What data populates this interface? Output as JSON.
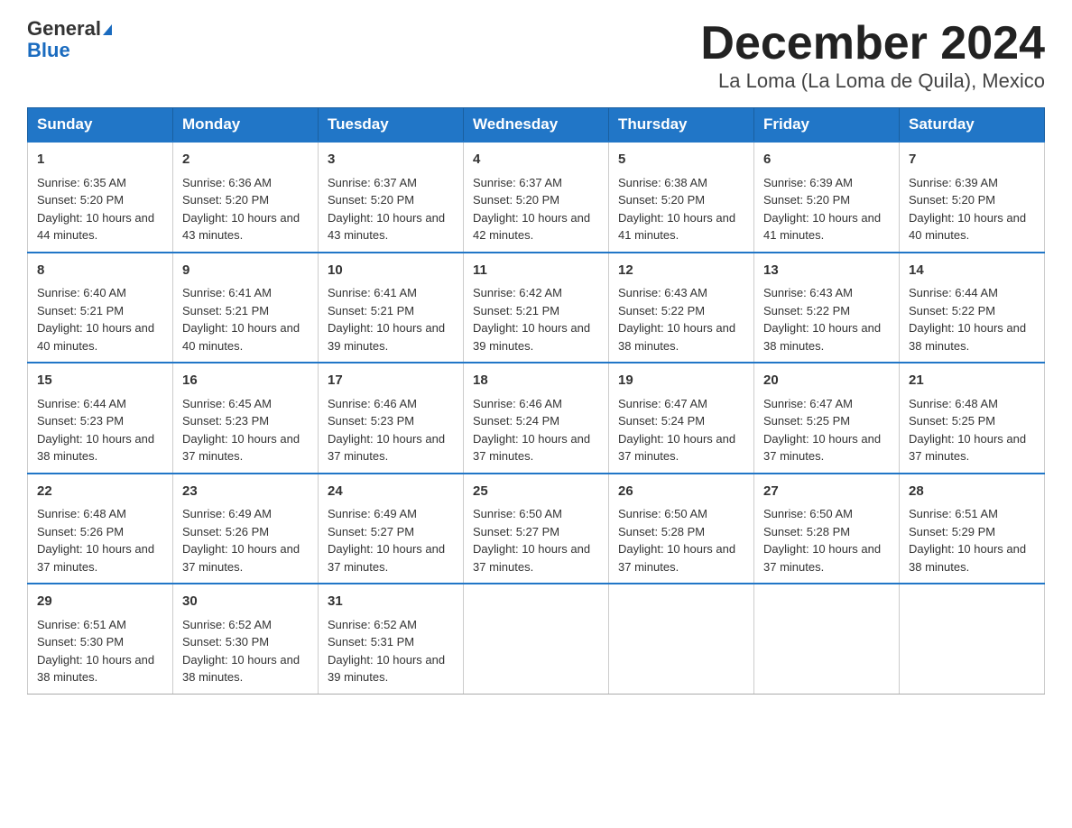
{
  "header": {
    "logo_general": "General",
    "logo_blue": "Blue",
    "title": "December 2024",
    "subtitle": "La Loma (La Loma de Quila), Mexico"
  },
  "days_of_week": [
    "Sunday",
    "Monday",
    "Tuesday",
    "Wednesday",
    "Thursday",
    "Friday",
    "Saturday"
  ],
  "weeks": [
    [
      {
        "day": "1",
        "sunrise": "6:35 AM",
        "sunset": "5:20 PM",
        "daylight": "10 hours and 44 minutes."
      },
      {
        "day": "2",
        "sunrise": "6:36 AM",
        "sunset": "5:20 PM",
        "daylight": "10 hours and 43 minutes."
      },
      {
        "day": "3",
        "sunrise": "6:37 AM",
        "sunset": "5:20 PM",
        "daylight": "10 hours and 43 minutes."
      },
      {
        "day": "4",
        "sunrise": "6:37 AM",
        "sunset": "5:20 PM",
        "daylight": "10 hours and 42 minutes."
      },
      {
        "day": "5",
        "sunrise": "6:38 AM",
        "sunset": "5:20 PM",
        "daylight": "10 hours and 41 minutes."
      },
      {
        "day": "6",
        "sunrise": "6:39 AM",
        "sunset": "5:20 PM",
        "daylight": "10 hours and 41 minutes."
      },
      {
        "day": "7",
        "sunrise": "6:39 AM",
        "sunset": "5:20 PM",
        "daylight": "10 hours and 40 minutes."
      }
    ],
    [
      {
        "day": "8",
        "sunrise": "6:40 AM",
        "sunset": "5:21 PM",
        "daylight": "10 hours and 40 minutes."
      },
      {
        "day": "9",
        "sunrise": "6:41 AM",
        "sunset": "5:21 PM",
        "daylight": "10 hours and 40 minutes."
      },
      {
        "day": "10",
        "sunrise": "6:41 AM",
        "sunset": "5:21 PM",
        "daylight": "10 hours and 39 minutes."
      },
      {
        "day": "11",
        "sunrise": "6:42 AM",
        "sunset": "5:21 PM",
        "daylight": "10 hours and 39 minutes."
      },
      {
        "day": "12",
        "sunrise": "6:43 AM",
        "sunset": "5:22 PM",
        "daylight": "10 hours and 38 minutes."
      },
      {
        "day": "13",
        "sunrise": "6:43 AM",
        "sunset": "5:22 PM",
        "daylight": "10 hours and 38 minutes."
      },
      {
        "day": "14",
        "sunrise": "6:44 AM",
        "sunset": "5:22 PM",
        "daylight": "10 hours and 38 minutes."
      }
    ],
    [
      {
        "day": "15",
        "sunrise": "6:44 AM",
        "sunset": "5:23 PM",
        "daylight": "10 hours and 38 minutes."
      },
      {
        "day": "16",
        "sunrise": "6:45 AM",
        "sunset": "5:23 PM",
        "daylight": "10 hours and 37 minutes."
      },
      {
        "day": "17",
        "sunrise": "6:46 AM",
        "sunset": "5:23 PM",
        "daylight": "10 hours and 37 minutes."
      },
      {
        "day": "18",
        "sunrise": "6:46 AM",
        "sunset": "5:24 PM",
        "daylight": "10 hours and 37 minutes."
      },
      {
        "day": "19",
        "sunrise": "6:47 AM",
        "sunset": "5:24 PM",
        "daylight": "10 hours and 37 minutes."
      },
      {
        "day": "20",
        "sunrise": "6:47 AM",
        "sunset": "5:25 PM",
        "daylight": "10 hours and 37 minutes."
      },
      {
        "day": "21",
        "sunrise": "6:48 AM",
        "sunset": "5:25 PM",
        "daylight": "10 hours and 37 minutes."
      }
    ],
    [
      {
        "day": "22",
        "sunrise": "6:48 AM",
        "sunset": "5:26 PM",
        "daylight": "10 hours and 37 minutes."
      },
      {
        "day": "23",
        "sunrise": "6:49 AM",
        "sunset": "5:26 PM",
        "daylight": "10 hours and 37 minutes."
      },
      {
        "day": "24",
        "sunrise": "6:49 AM",
        "sunset": "5:27 PM",
        "daylight": "10 hours and 37 minutes."
      },
      {
        "day": "25",
        "sunrise": "6:50 AM",
        "sunset": "5:27 PM",
        "daylight": "10 hours and 37 minutes."
      },
      {
        "day": "26",
        "sunrise": "6:50 AM",
        "sunset": "5:28 PM",
        "daylight": "10 hours and 37 minutes."
      },
      {
        "day": "27",
        "sunrise": "6:50 AM",
        "sunset": "5:28 PM",
        "daylight": "10 hours and 37 minutes."
      },
      {
        "day": "28",
        "sunrise": "6:51 AM",
        "sunset": "5:29 PM",
        "daylight": "10 hours and 38 minutes."
      }
    ],
    [
      {
        "day": "29",
        "sunrise": "6:51 AM",
        "sunset": "5:30 PM",
        "daylight": "10 hours and 38 minutes."
      },
      {
        "day": "30",
        "sunrise": "6:52 AM",
        "sunset": "5:30 PM",
        "daylight": "10 hours and 38 minutes."
      },
      {
        "day": "31",
        "sunrise": "6:52 AM",
        "sunset": "5:31 PM",
        "daylight": "10 hours and 39 minutes."
      },
      null,
      null,
      null,
      null
    ]
  ]
}
